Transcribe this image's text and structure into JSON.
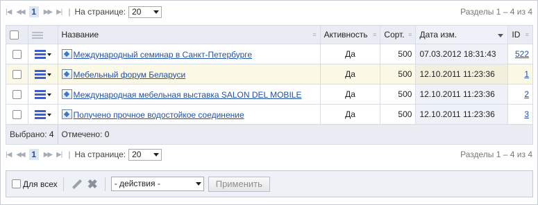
{
  "pager": {
    "first_icon": "first-page-icon",
    "prev_icon": "prev-page-icon",
    "current_page": "1",
    "next_icon": "next-page-icon",
    "last_icon": "last-page-icon",
    "separator": "|",
    "per_page_label": "На странице:",
    "per_page_value": "20",
    "sections_summary": "Разделы 1 – 4 из 4"
  },
  "table": {
    "columns": {
      "name": "Название",
      "active": "Активность",
      "sort": "Сорт.",
      "date": "Дата изм.",
      "id": "ID"
    },
    "rows": [
      {
        "name": "Международный семинар в Санкт-Петербурге",
        "active": "Да",
        "sort": "500",
        "date": "07.03.2012 18:31:43",
        "id": "522"
      },
      {
        "name": "Мебельный форум Беларуси",
        "active": "Да",
        "sort": "500",
        "date": "12.10.2011 11:23:36",
        "id": "1"
      },
      {
        "name": "Международная мебельная выставка SALON DEL MOBILE",
        "active": "Да",
        "sort": "500",
        "date": "12.10.2011 11:23:36",
        "id": "2"
      },
      {
        "name": "Получено прочное водостойкое соединение",
        "active": "Да",
        "sort": "500",
        "date": "12.10.2011 11:23:36",
        "id": "3"
      }
    ],
    "footer": {
      "selected_label": "Выбрано:",
      "selected_value": "4",
      "checked_label": "Отмечено:",
      "checked_value": "0"
    }
  },
  "action_bar": {
    "for_all_label": "Для всех",
    "edit_icon": "pencil-icon",
    "delete_icon": "delete-x-icon",
    "actions_value": "- действия -",
    "apply_label": "Применить"
  },
  "colors": {
    "accent": "#2251a8",
    "header_bg": "#e9edf3",
    "highlight_row": "#fbf9e6"
  }
}
